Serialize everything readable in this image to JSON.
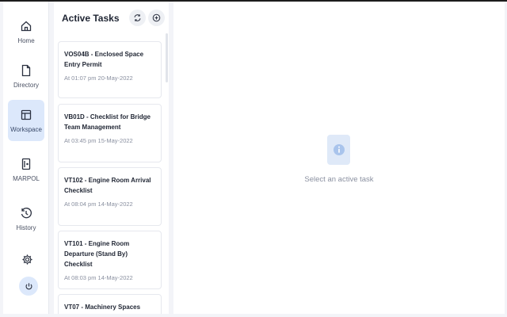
{
  "sidebar": {
    "items": [
      {
        "label": "Home",
        "icon": "home-icon"
      },
      {
        "label": "Directory",
        "icon": "file-icon"
      },
      {
        "label": "Workspace",
        "icon": "layout-icon",
        "active": true
      },
      {
        "label": "MARPOL",
        "icon": "book-icon"
      },
      {
        "label": "History",
        "icon": "history-icon"
      }
    ],
    "settings_icon": "gear-icon",
    "power_icon": "power-icon"
  },
  "tasks_panel": {
    "title": "Active Tasks",
    "tasks": [
      {
        "title": "VOS04B - Enclosed Space Entry Permit",
        "time": "At 01:07 pm 20-May-2022"
      },
      {
        "title": "VB01D - Checklist for Bridge Team Management",
        "time": "At 03:45 pm 15-May-2022"
      },
      {
        "title": "VT102 - Engine Room Arrival Checklist",
        "time": "At 08:04 pm 14-May-2022"
      },
      {
        "title": "VT101 - Engine Room Departure (Stand By) Checklist",
        "time": "At 08:03 pm 14-May-2022"
      },
      {
        "title": "VT07 - Machinery Spaces",
        "time": ""
      }
    ]
  },
  "main": {
    "empty_text": "Select an active task",
    "info_icon": "info-icon"
  },
  "colors": {
    "accent": "#dce8fb",
    "info": "#a9c4ec"
  }
}
